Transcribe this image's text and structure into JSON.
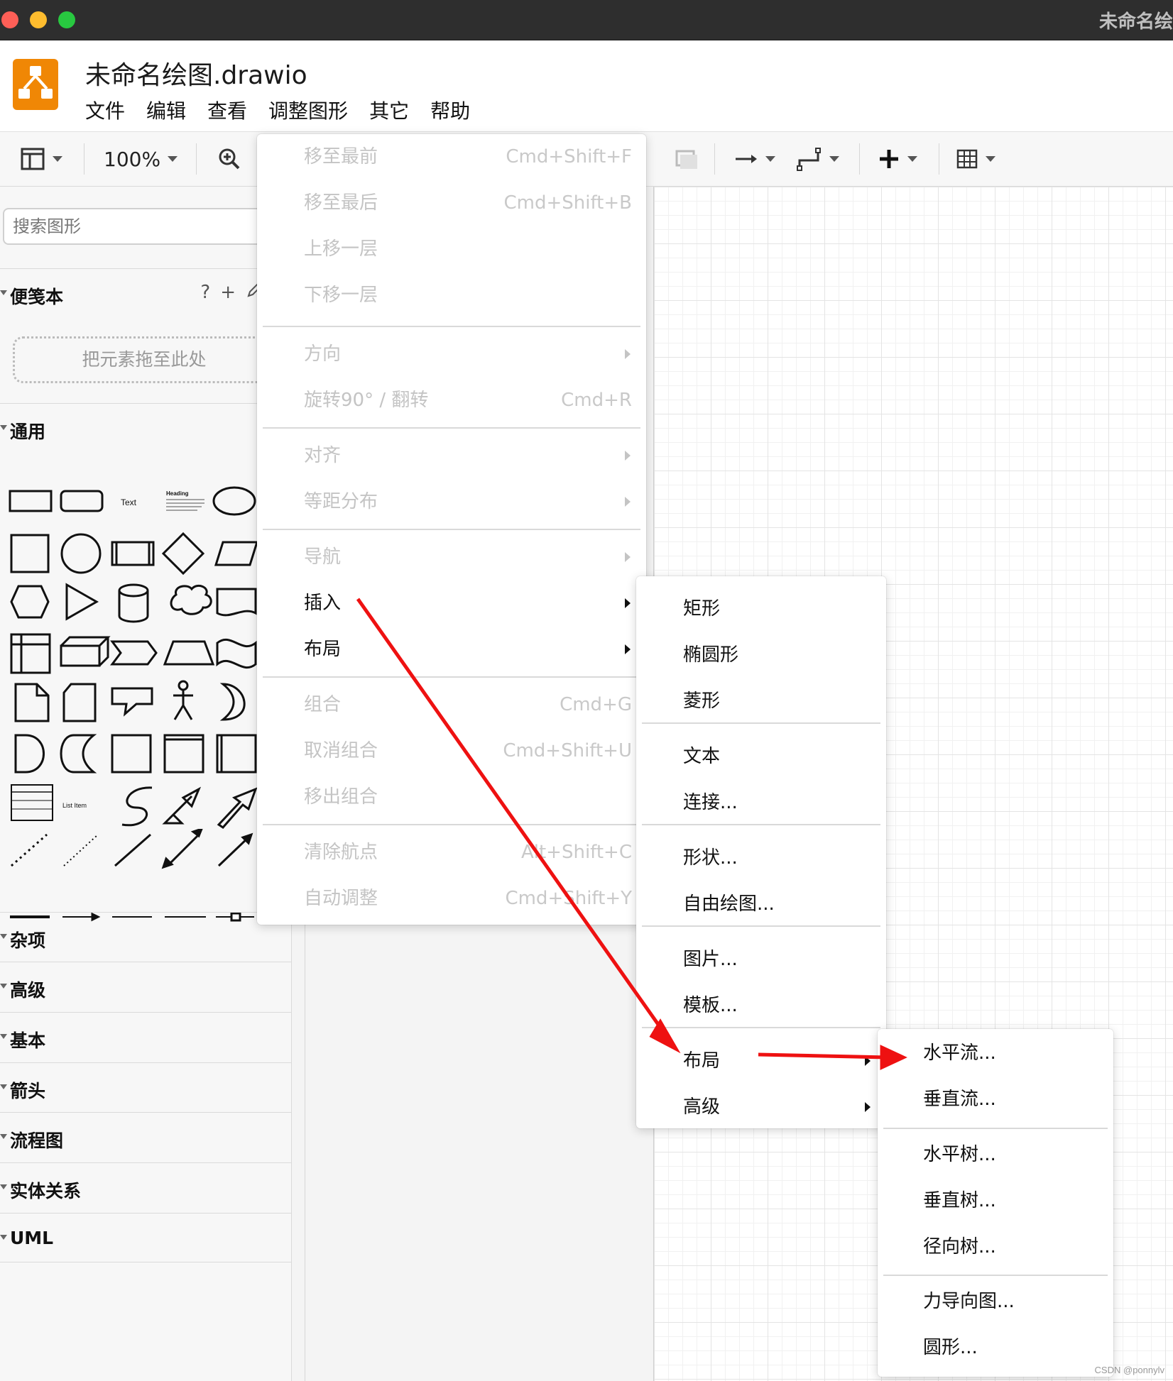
{
  "window": {
    "title": "未命名绘"
  },
  "app": {
    "doc_title": "未命名绘图.drawio"
  },
  "menubar": [
    "文件",
    "编辑",
    "查看",
    "调整图形",
    "其它",
    "帮助"
  ],
  "toolbar": {
    "zoom": "100%"
  },
  "sidebar": {
    "search_placeholder": "搜索图形",
    "scratchpad": {
      "title": "便笺本",
      "help": "?",
      "add": "+",
      "dropzone": "把元素拖至此处"
    },
    "general": {
      "title": "通用",
      "shape_text": "Text",
      "shape_heading": "Heading",
      "shape_list_item": "List Item"
    },
    "sections": [
      "杂项",
      "高级",
      "基本",
      "箭头",
      "流程图",
      "实体关系",
      "UML"
    ]
  },
  "arrange_menu": [
    {
      "label": "移至最前",
      "shortcut": "Cmd+Shift+F"
    },
    {
      "label": "移至最后",
      "shortcut": "Cmd+Shift+B"
    },
    {
      "label": "上移一层",
      "shortcut": ""
    },
    {
      "label": "下移一层",
      "shortcut": ""
    },
    {
      "label": "方向",
      "shortcut": ""
    },
    {
      "label": "旋转90° / 翻转",
      "shortcut": "Cmd+R"
    },
    {
      "label": "对齐",
      "shortcut": ""
    },
    {
      "label": "等距分布",
      "shortcut": ""
    },
    {
      "label": "导航",
      "shortcut": ""
    },
    {
      "label": "插入",
      "shortcut": ""
    },
    {
      "label": "布局",
      "shortcut": ""
    },
    {
      "label": "组合",
      "shortcut": "Cmd+G"
    },
    {
      "label": "取消组合",
      "shortcut": "Cmd+Shift+U"
    },
    {
      "label": "移出组合",
      "shortcut": ""
    },
    {
      "label": "清除航点",
      "shortcut": "Alt+Shift+C"
    },
    {
      "label": "自动调整",
      "shortcut": "Cmd+Shift+Y"
    }
  ],
  "insert_menu": [
    "矩形",
    "椭圆形",
    "菱形",
    "文本",
    "连接...",
    "形状...",
    "自由绘图...",
    "图片...",
    "模板...",
    "布局",
    "高级"
  ],
  "layout_menu": [
    "水平流...",
    "垂直流...",
    "水平树...",
    "垂直树...",
    "径向树...",
    "力导向图...",
    "圆形..."
  ],
  "colors": {
    "annotation_arrow": "#ee1111",
    "logo": "#f08705"
  },
  "watermark": "CSDN @ponnylv"
}
